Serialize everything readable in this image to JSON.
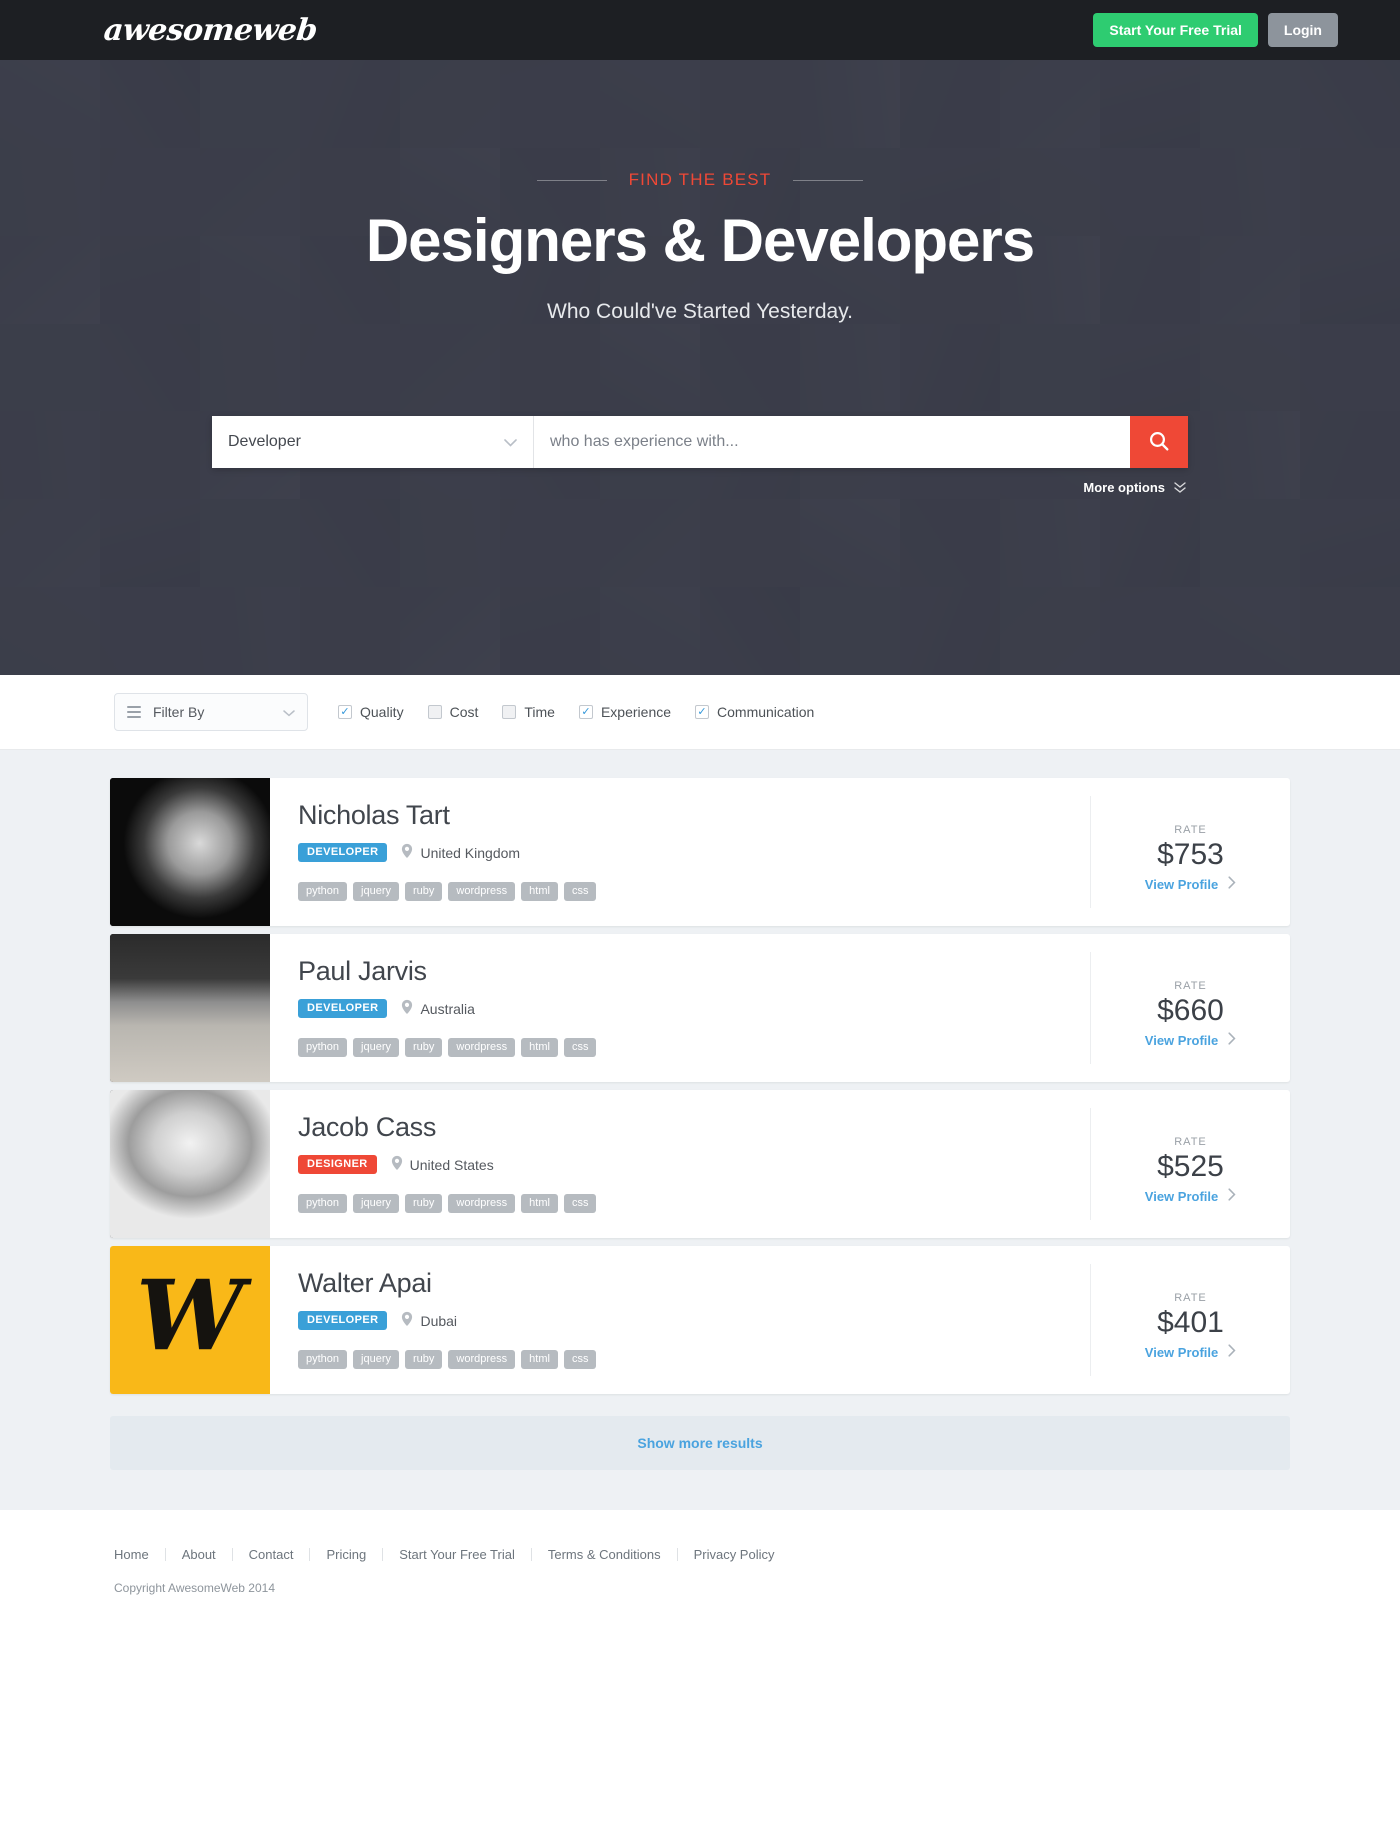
{
  "header": {
    "logo": "awesomeweb",
    "trial_button": "Start Your Free Trial",
    "login_button": "Login",
    "trial_color": "#2ecc71",
    "login_color": "#8d949c",
    "bg_color": "#1d1f23"
  },
  "hero": {
    "eyebrow": "FIND THE BEST",
    "eyebrow_color": "#ef4836",
    "title": "Designers & Developers",
    "subtitle": "Who Could've Started Yesterday.",
    "search": {
      "category_value": "Developer",
      "query_placeholder": "who has experience with...",
      "query_value": "",
      "search_icon": "magnifier-icon",
      "search_button_color": "#ef4836",
      "more_options_label": "More options"
    }
  },
  "filterbar": {
    "filter_by_label": "Filter By",
    "checkboxes": [
      {
        "label": "Quality",
        "checked": true
      },
      {
        "label": "Cost",
        "checked": false
      },
      {
        "label": "Time",
        "checked": false
      },
      {
        "label": "Experience",
        "checked": true
      },
      {
        "label": "Communication",
        "checked": true
      }
    ]
  },
  "results": {
    "rate_label": "RATE",
    "view_profile_label": "View Profile",
    "show_more_label": "Show more results",
    "cards": [
      {
        "name": "Nicholas Tart",
        "role": "DEVELOPER",
        "role_type": "dev",
        "location": "United Kingdom",
        "tags": [
          "python",
          "jquery",
          "ruby",
          "wordpress",
          "html",
          "css"
        ],
        "rate": "$753",
        "avatar_type": "photo-bw-dark"
      },
      {
        "name": "Paul Jarvis",
        "role": "DEVELOPER",
        "role_type": "dev",
        "location": "Australia",
        "tags": [
          "python",
          "jquery",
          "ruby",
          "wordpress",
          "html",
          "css"
        ],
        "rate": "$660",
        "avatar_type": "photo-beanie"
      },
      {
        "name": "Jacob Cass",
        "role": "DESIGNER",
        "role_type": "des",
        "location": "United States",
        "tags": [
          "python",
          "jquery",
          "ruby",
          "wordpress",
          "html",
          "css"
        ],
        "rate": "$525",
        "avatar_type": "photo-bw-light"
      },
      {
        "name": "Walter Apai",
        "role": "DEVELOPER",
        "role_type": "dev",
        "location": "Dubai",
        "tags": [
          "python",
          "jquery",
          "ruby",
          "wordpress",
          "html",
          "css"
        ],
        "rate": "$401",
        "avatar_type": "logo-w",
        "avatar_letter": "W",
        "avatar_bg": "#f9b818"
      }
    ]
  },
  "footer": {
    "links": [
      "Home",
      "About",
      "Contact",
      "Pricing",
      "Start Your Free Trial",
      "Terms & Conditions",
      "Privacy Policy"
    ],
    "copyright": "Copyright AwesomeWeb 2014"
  },
  "colors": {
    "accent_red": "#ef4836",
    "accent_blue": "#3aa0d8",
    "accent_green": "#2ecc71",
    "link_blue": "#4aa3df"
  }
}
